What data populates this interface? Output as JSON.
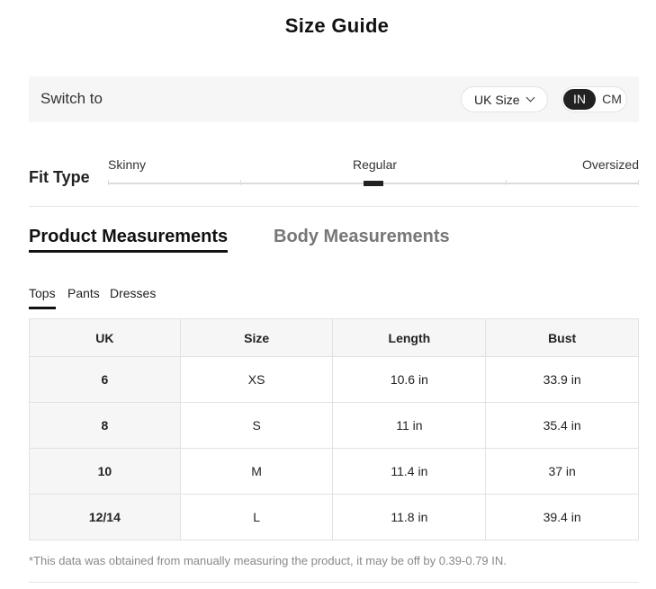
{
  "title": "Size Guide",
  "switch_bar": {
    "label": "Switch to",
    "size_system": "UK Size",
    "units": [
      "IN",
      "CM"
    ],
    "active_unit": "IN"
  },
  "fit": {
    "label": "Fit Type",
    "options": [
      "Skinny",
      "Regular",
      "Oversized"
    ],
    "selected": "Regular"
  },
  "measurement_tabs": {
    "active": "Product Measurements",
    "inactive": "Body Measurements"
  },
  "category_tabs": [
    "Tops",
    "Pants",
    "Dresses"
  ],
  "table": {
    "headers": [
      "UK",
      "Size",
      "Length",
      "Bust"
    ],
    "rows": [
      [
        "6",
        "XS",
        "10.6 in",
        "33.9 in"
      ],
      [
        "8",
        "S",
        "11 in",
        "35.4 in"
      ],
      [
        "10",
        "M",
        "11.4 in",
        "37 in"
      ],
      [
        "12/14",
        "L",
        "11.8 in",
        "39.4 in"
      ]
    ]
  },
  "footnote": "*This data was obtained from manually measuring the product, it may be off by 0.39-0.79 IN."
}
